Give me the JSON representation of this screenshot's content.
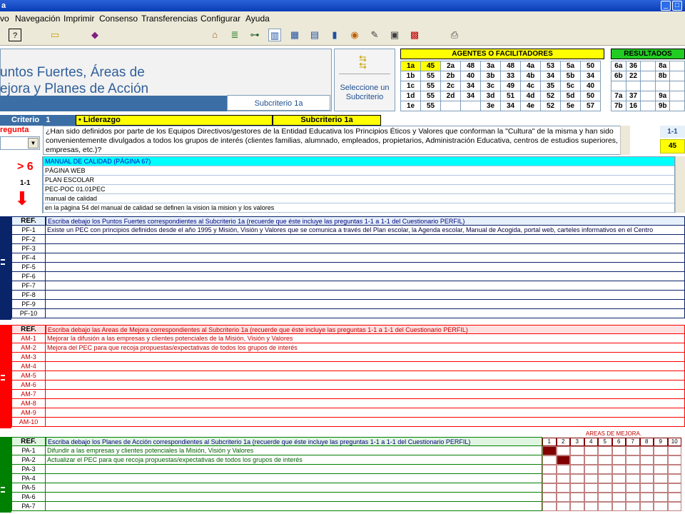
{
  "window": {
    "title": "a"
  },
  "menu": [
    "vo",
    "Navegación",
    "Imprimir",
    "Consenso",
    "Transferencias",
    "Configurar",
    "Ayuda"
  ],
  "header": {
    "title_line1": "untos Fuertes, Áreas de",
    "title_line2": "ejora y Planes de Acción",
    "subcriterio_label": "Subcriterio 1a",
    "select_label": "Seleccione un Subcriterio"
  },
  "agentes": {
    "title": "AGENTES O FACILITADORES",
    "rows": [
      [
        "1a",
        "45",
        "2a",
        "48",
        "3a",
        "48",
        "4a",
        "53",
        "5a",
        "50"
      ],
      [
        "1b",
        "55",
        "2b",
        "40",
        "3b",
        "33",
        "4b",
        "34",
        "5b",
        "34"
      ],
      [
        "1c",
        "55",
        "2c",
        "34",
        "3c",
        "49",
        "4c",
        "35",
        "5c",
        "40"
      ],
      [
        "1d",
        "55",
        "2d",
        "34",
        "3d",
        "51",
        "4d",
        "52",
        "5d",
        "50"
      ],
      [
        "1e",
        "55",
        "",
        "",
        "3e",
        "34",
        "4e",
        "52",
        "5e",
        "57"
      ]
    ]
  },
  "resultados": {
    "title": "RESULTADOS",
    "rows": [
      [
        "6a",
        "36",
        "",
        "8a",
        ""
      ],
      [
        "6b",
        "22",
        "",
        "8b",
        ""
      ],
      [
        "",
        "",
        "",
        "",
        ""
      ],
      [
        "7a",
        "37",
        "",
        "9a",
        ""
      ],
      [
        "7b",
        "16",
        "",
        "9b",
        ""
      ]
    ]
  },
  "critbar": {
    "criterio_label": "Criterio",
    "criterio_num": "1",
    "criterio_name": "• Liderazgo",
    "subcriterio": "Subcriterio 1a"
  },
  "question": {
    "label": "regunta",
    "text": "¿Han sido definidos por parte de los Equipos Directivos/gestores de la  Entidad Educativa los Principios Éticos y Valores que conforman la \"Cultura\" de la misma y han sido convenientemente divulgados a todos los grupos de interés (clientes familias, alumnado, empleados, propietarios, Administración Educativa, centros de estudios superiores, empresas, etc.)?",
    "code": "1-1",
    "score": "45"
  },
  "evidence": {
    "indicator": "> 6",
    "code": "1-1",
    "items": [
      "MANUAL DE CALIDAD (PÁGINA 67)",
      "PÁGINA WEB",
      "PLAN ESCOLAR",
      "PEC-POC 01.01PEC",
      "manual de calidad",
      "en la página 54 del manual de calidad se definen la vision la mision y los valores"
    ]
  },
  "pf": {
    "ref": "REF.",
    "header": "Escriba debajo los Puntos Fuertes correspondientes al Subcriterio 1a (recuerde que éste incluye las preguntas 1-1 a 1-1 del Cuestionario PERFIL)",
    "refs": [
      "PF-1",
      "PF-2",
      "PF-3",
      "PF-4",
      "PF-5",
      "PF-6",
      "PF-7",
      "PF-8",
      "PF-9",
      "PF-10"
    ],
    "texts": [
      "Existe un PEC con principios definidos desde el año 1995 y Misión, Visión y Valores que se comunica a través del Plan escolar, la Agenda escolar, Manual de Acogida, portal web, carteles informativos en el Centro",
      "",
      "",
      "",
      "",
      "",
      "",
      "",
      "",
      ""
    ]
  },
  "am": {
    "ref": "REF.",
    "header": "Escriba debajo las Areas de Mejora correspondientes al Subcriterio 1a (recuerde que éste incluye las preguntas 1-1 a 1-1 del Cuestionario PERFIL)",
    "refs": [
      "AM-1",
      "AM-2",
      "AM-3",
      "AM-4",
      "AM-5",
      "AM-6",
      "AM-7",
      "AM-8",
      "AM-9",
      "AM-10"
    ],
    "texts": [
      "Mejorar la difusión a las empresas y clientes potenciales de la Misión, Visión y Valores",
      "Mejora del PEC para que recoja propuestas/expectativas de todos los grupos de interés",
      "",
      "",
      "",
      "",
      "",
      "",
      "",
      ""
    ]
  },
  "pa": {
    "ref": "REF.",
    "header": "Escriba debajo los Planes de Acción correspondientes al Subcriterio 1a (recuerde que éste incluye las preguntas 1-1 a 1-1 del Cuestionario PERFIL)",
    "refs": [
      "PA-1",
      "PA-2",
      "PA-3",
      "PA-4",
      "PA-5",
      "PA-6",
      "PA-7"
    ],
    "texts": [
      "Difundir a las empresas y clientes potenciales la Misión, Visión y Valores",
      "Actualizar el PEC para que recoja propuestas/expectativas de todos los grupos de interés",
      "",
      "",
      "",
      "",
      ""
    ],
    "areas_title": "AREAS DE MEJORA.",
    "areas_cols": [
      "1",
      "2",
      "3",
      "4",
      "5",
      "6",
      "7",
      "8",
      "9",
      "10"
    ],
    "areas_checked": [
      [
        1
      ],
      [
        2
      ],
      [],
      [],
      [],
      [],
      []
    ]
  },
  "colors": {
    "blue": "#0a246a",
    "red": "#ff0000",
    "green": "#008000",
    "yellow": "#ffff00",
    "darkred": "#800000"
  }
}
